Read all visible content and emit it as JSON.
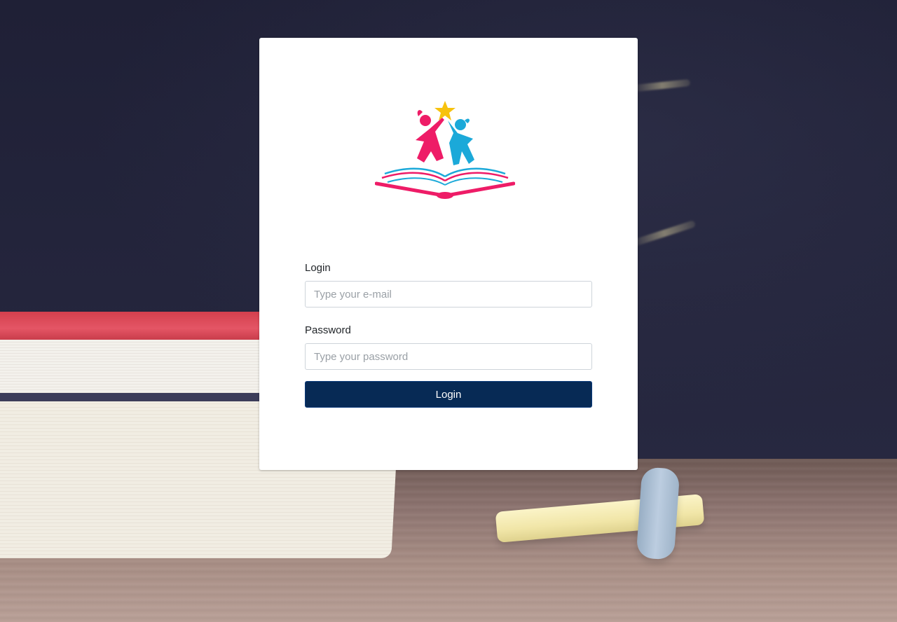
{
  "background": {
    "description_icon": "school-books-chalkboard-background"
  },
  "logo": {
    "icon": "kids-reading-book-star-logo",
    "colors": {
      "pink": "#ee1c67",
      "blue": "#1ba9d9",
      "star": "#f7c20e"
    }
  },
  "form": {
    "email_label": "Login",
    "email_placeholder": "Type your e-mail",
    "email_value": "",
    "password_label": "Password",
    "password_placeholder": "Type your password",
    "password_value": "",
    "submit_label": "Login"
  },
  "colors": {
    "primary_button": "#072a55",
    "card_background": "#ffffff"
  }
}
